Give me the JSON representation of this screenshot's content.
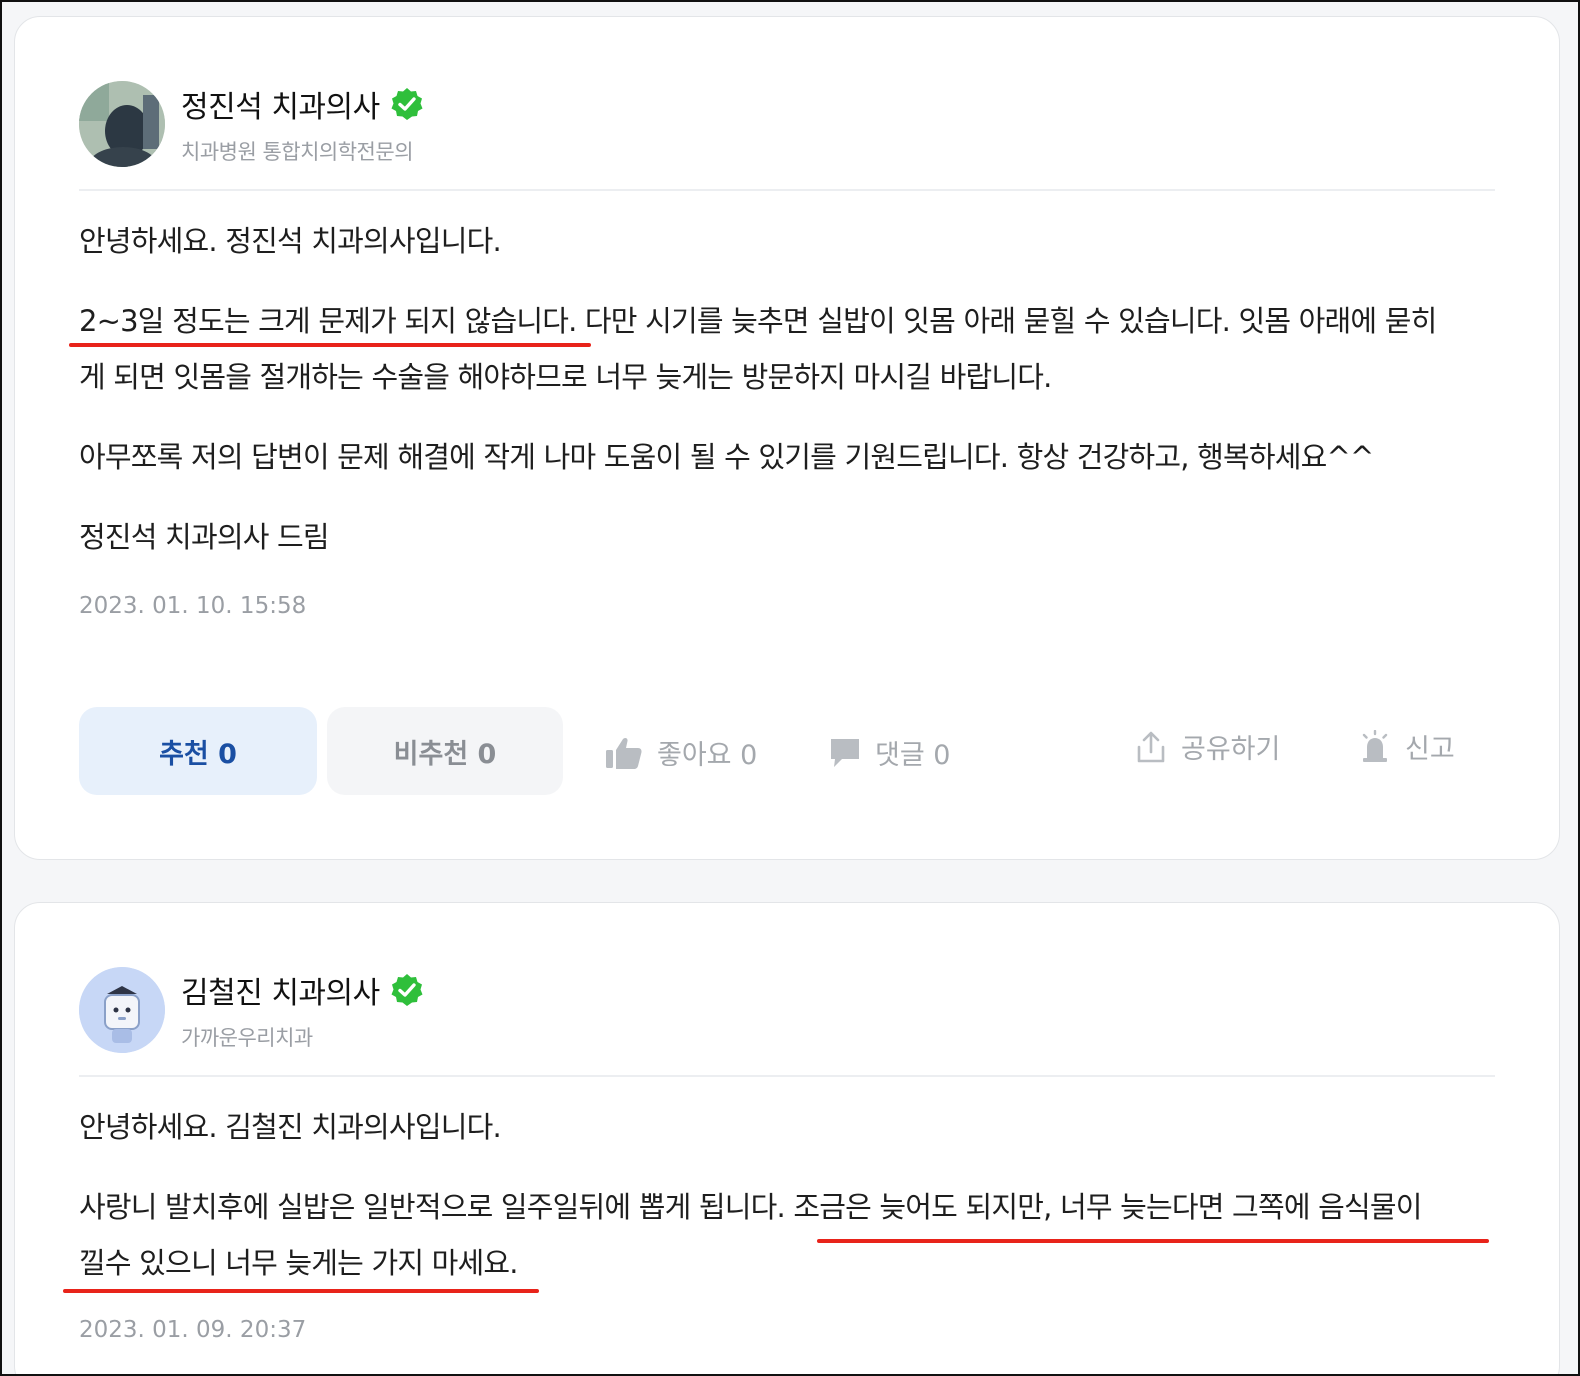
{
  "answers": [
    {
      "author": {
        "name": "정진석 치과의사",
        "affiliation": "치과병원 통합치의학전문의",
        "verified_icon": "check-badge-icon"
      },
      "paragraphs": [
        "안녕하세요. 정진석 치과의사입니다.",
        "2~3일 정도는 크게 문제가 되지 않습니다. 다만 시기를 늦추면 실밥이 잇몸 아래 묻힐 수 있습니다. 잇몸 아래에 묻히",
        "게 되면 잇몸을 절개하는 수술을 해야하므로 너무 늦게는 방문하지 마시길 바랍니다.",
        "아무쪼록 저의 답변이 문제 해결에 작게 나마 도움이 될 수 있기를 기원드립니다. 항상 건강하고, 행복하세요^^",
        "정진석 치과의사 드림"
      ],
      "date": "2023. 01. 10. 15:58",
      "actions": {
        "recommend": "추천 0",
        "not_recommend": "비추천 0",
        "like": "좋아요 0",
        "comment": "댓글 0",
        "share": "공유하기",
        "report": "신고"
      }
    },
    {
      "author": {
        "name": "김철진 치과의사",
        "affiliation": "가까운우리치과",
        "verified_icon": "check-badge-icon"
      },
      "paragraphs": [
        "안녕하세요. 김철진 치과의사입니다.",
        "사랑니 발치후에 실밥은 일반적으로 일주일뒤에 뽑게 됩니다. 조금은 늦어도 되지만, 너무 늦는다면 그쪽에 음식물이",
        "낄수 있으니 너무 늦게는 가지 마세요."
      ],
      "date": "2023. 01. 09. 20:37"
    }
  ],
  "colors": {
    "accent_blue": "#1a4fa3",
    "verified_green": "#2fbf3b",
    "annotation_red": "#e8231a"
  }
}
